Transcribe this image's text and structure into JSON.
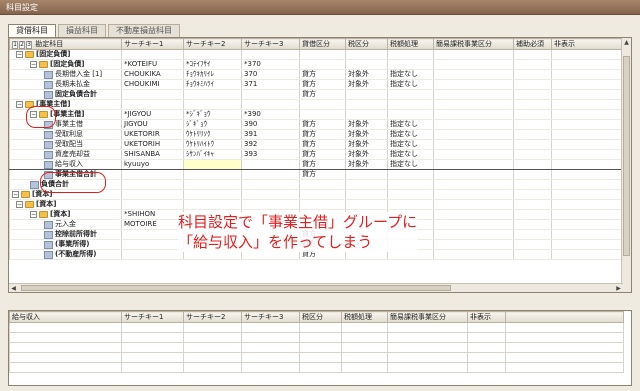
{
  "window": {
    "title": "科目設定"
  },
  "tabs": [
    {
      "label": "貸借科目"
    },
    {
      "label": "損益科目"
    },
    {
      "label": "不動産損益科目"
    }
  ],
  "grid": {
    "levels": [
      "1",
      "2",
      "3"
    ],
    "headers": {
      "name": "勘定科目",
      "key1": "サーチキー1",
      "key2": "サーチキー2",
      "key3": "サーチキー3",
      "dc": "貸借区分",
      "tax": "税区分",
      "taxproc": "税額処理",
      "simple": "簡易課税事業区分",
      "aux": "補助必須",
      "hidden": "非表示"
    },
    "rows": [
      {
        "name": "[固定負債]",
        "k1": "",
        "k2": "",
        "k3": "",
        "dc": "",
        "tax": "",
        "tp": ""
      },
      {
        "name": "[固定負債]",
        "k1": "*KOTEIFU",
        "k2": "*ｺﾃｲﾌｻｲ",
        "k3": "*370",
        "dc": "",
        "tax": "",
        "tp": ""
      },
      {
        "name": "長期借入金 [1]",
        "k1": "CHOUKIKA",
        "k2": "ﾁｮｳｷｶﾘｲﾚ",
        "k3": "370",
        "dc": "貸方",
        "tax": "対象外",
        "tp": "指定なし"
      },
      {
        "name": "長期未払金",
        "k1": "CHOUKIMI",
        "k2": "ﾁｮｳｷﾐﾊﾗｲ",
        "k3": "371",
        "dc": "貸方",
        "tax": "対象外",
        "tp": "指定なし"
      },
      {
        "name": "固定負債合計",
        "k1": "",
        "k2": "",
        "k3": "",
        "dc": "貸方",
        "tax": "",
        "tp": ""
      },
      {
        "name": "[事業主借]",
        "k1": "",
        "k2": "",
        "k3": "",
        "dc": "",
        "tax": "",
        "tp": ""
      },
      {
        "name": "[事業主借]",
        "k1": "*JIGYOU",
        "k2": "*ｼﾞｷﾞｮｳ",
        "k3": "*390",
        "dc": "",
        "tax": "",
        "tp": ""
      },
      {
        "name": "事業主借",
        "k1": "JIGYOU",
        "k2": "ｼﾞｷﾞｮｳ",
        "k3": "390",
        "dc": "貸方",
        "tax": "対象外",
        "tp": "指定なし"
      },
      {
        "name": "受取利息",
        "k1": "UKETORIR",
        "k2": "ｳｹﾄﾘﾘｿｸ",
        "k3": "391",
        "dc": "貸方",
        "tax": "対象外",
        "tp": "指定なし"
      },
      {
        "name": "受取配当",
        "k1": "UKETORIH",
        "k2": "ｳｹﾄﾘﾊｲﾄｳ",
        "k3": "392",
        "dc": "貸方",
        "tax": "対象外",
        "tp": "指定なし"
      },
      {
        "name": "資産売却益",
        "k1": "SHISANBA",
        "k2": "ｼｻﾝﾊﾞｲｷｬ",
        "k3": "393",
        "dc": "貸方",
        "tax": "対象外",
        "tp": "指定なし"
      },
      {
        "name": "給与収入",
        "k1": "kyuuyo",
        "k2": "",
        "k3": "",
        "dc": "貸方",
        "tax": "対象外",
        "tp": "指定なし"
      },
      {
        "name": "事業主借合計",
        "k1": "",
        "k2": "",
        "k3": "",
        "dc": "貸方",
        "tax": "",
        "tp": ""
      },
      {
        "name": "負債合計",
        "k1": "",
        "k2": "",
        "k3": "",
        "dc": "",
        "tax": "",
        "tp": ""
      },
      {
        "name": "[資本]",
        "k1": "",
        "k2": "",
        "k3": "",
        "dc": "",
        "tax": "",
        "tp": ""
      },
      {
        "name": "[資本]",
        "k1": "",
        "k2": "",
        "k3": "",
        "dc": "",
        "tax": "",
        "tp": ""
      },
      {
        "name": "[資本]",
        "k1": "*SHIHON",
        "k2": "",
        "k3": "",
        "dc": "",
        "tax": "",
        "tp": ""
      },
      {
        "name": "元入金",
        "k1": "MOTOIRE",
        "k2": "",
        "k3": "",
        "dc": "",
        "tax": "",
        "tp": ""
      },
      {
        "name": "控除前所得計",
        "k1": "",
        "k2": "",
        "k3": "",
        "dc": "貸方",
        "tax": "",
        "tp": ""
      },
      {
        "name": "(事業所得)",
        "k1": "",
        "k2": "",
        "k3": "",
        "dc": "貸方",
        "tax": "",
        "tp": ""
      },
      {
        "name": "(不動産所得)",
        "k1": "",
        "k2": "",
        "k3": "",
        "dc": "貸方",
        "tax": "",
        "tp": ""
      }
    ]
  },
  "detail": {
    "title": "給与収入",
    "headers": [
      "サーチキー1",
      "サーチキー2",
      "サーチキー3",
      "税区分",
      "税額処理",
      "簡易課税事業区分",
      "非表示"
    ]
  },
  "annotation": {
    "line1": "科目設定で「事業主借」グループに",
    "line2": "「給与収入」を作ってしまう",
    "color": "#e0201f"
  }
}
